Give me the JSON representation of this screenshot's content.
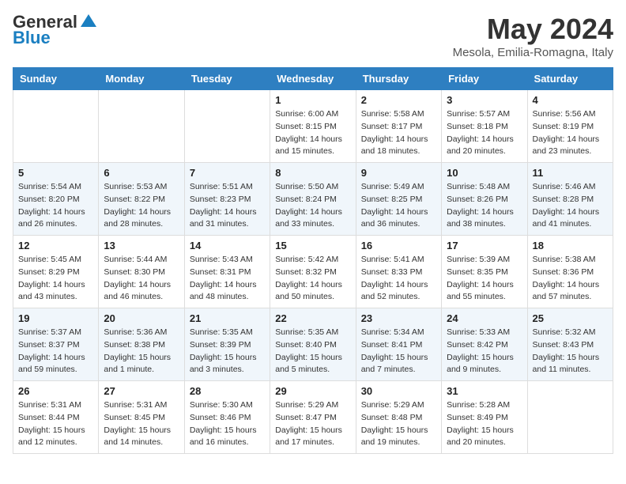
{
  "header": {
    "logo_line1": "General",
    "logo_line2": "Blue",
    "month_year": "May 2024",
    "location": "Mesola, Emilia-Romagna, Italy"
  },
  "days_of_week": [
    "Sunday",
    "Monday",
    "Tuesday",
    "Wednesday",
    "Thursday",
    "Friday",
    "Saturday"
  ],
  "weeks": [
    [
      {
        "day": "",
        "info": ""
      },
      {
        "day": "",
        "info": ""
      },
      {
        "day": "",
        "info": ""
      },
      {
        "day": "1",
        "info": "Sunrise: 6:00 AM\nSunset: 8:15 PM\nDaylight: 14 hours\nand 15 minutes."
      },
      {
        "day": "2",
        "info": "Sunrise: 5:58 AM\nSunset: 8:17 PM\nDaylight: 14 hours\nand 18 minutes."
      },
      {
        "day": "3",
        "info": "Sunrise: 5:57 AM\nSunset: 8:18 PM\nDaylight: 14 hours\nand 20 minutes."
      },
      {
        "day": "4",
        "info": "Sunrise: 5:56 AM\nSunset: 8:19 PM\nDaylight: 14 hours\nand 23 minutes."
      }
    ],
    [
      {
        "day": "5",
        "info": "Sunrise: 5:54 AM\nSunset: 8:20 PM\nDaylight: 14 hours\nand 26 minutes."
      },
      {
        "day": "6",
        "info": "Sunrise: 5:53 AM\nSunset: 8:22 PM\nDaylight: 14 hours\nand 28 minutes."
      },
      {
        "day": "7",
        "info": "Sunrise: 5:51 AM\nSunset: 8:23 PM\nDaylight: 14 hours\nand 31 minutes."
      },
      {
        "day": "8",
        "info": "Sunrise: 5:50 AM\nSunset: 8:24 PM\nDaylight: 14 hours\nand 33 minutes."
      },
      {
        "day": "9",
        "info": "Sunrise: 5:49 AM\nSunset: 8:25 PM\nDaylight: 14 hours\nand 36 minutes."
      },
      {
        "day": "10",
        "info": "Sunrise: 5:48 AM\nSunset: 8:26 PM\nDaylight: 14 hours\nand 38 minutes."
      },
      {
        "day": "11",
        "info": "Sunrise: 5:46 AM\nSunset: 8:28 PM\nDaylight: 14 hours\nand 41 minutes."
      }
    ],
    [
      {
        "day": "12",
        "info": "Sunrise: 5:45 AM\nSunset: 8:29 PM\nDaylight: 14 hours\nand 43 minutes."
      },
      {
        "day": "13",
        "info": "Sunrise: 5:44 AM\nSunset: 8:30 PM\nDaylight: 14 hours\nand 46 minutes."
      },
      {
        "day": "14",
        "info": "Sunrise: 5:43 AM\nSunset: 8:31 PM\nDaylight: 14 hours\nand 48 minutes."
      },
      {
        "day": "15",
        "info": "Sunrise: 5:42 AM\nSunset: 8:32 PM\nDaylight: 14 hours\nand 50 minutes."
      },
      {
        "day": "16",
        "info": "Sunrise: 5:41 AM\nSunset: 8:33 PM\nDaylight: 14 hours\nand 52 minutes."
      },
      {
        "day": "17",
        "info": "Sunrise: 5:39 AM\nSunset: 8:35 PM\nDaylight: 14 hours\nand 55 minutes."
      },
      {
        "day": "18",
        "info": "Sunrise: 5:38 AM\nSunset: 8:36 PM\nDaylight: 14 hours\nand 57 minutes."
      }
    ],
    [
      {
        "day": "19",
        "info": "Sunrise: 5:37 AM\nSunset: 8:37 PM\nDaylight: 14 hours\nand 59 minutes."
      },
      {
        "day": "20",
        "info": "Sunrise: 5:36 AM\nSunset: 8:38 PM\nDaylight: 15 hours\nand 1 minute."
      },
      {
        "day": "21",
        "info": "Sunrise: 5:35 AM\nSunset: 8:39 PM\nDaylight: 15 hours\nand 3 minutes."
      },
      {
        "day": "22",
        "info": "Sunrise: 5:35 AM\nSunset: 8:40 PM\nDaylight: 15 hours\nand 5 minutes."
      },
      {
        "day": "23",
        "info": "Sunrise: 5:34 AM\nSunset: 8:41 PM\nDaylight: 15 hours\nand 7 minutes."
      },
      {
        "day": "24",
        "info": "Sunrise: 5:33 AM\nSunset: 8:42 PM\nDaylight: 15 hours\nand 9 minutes."
      },
      {
        "day": "25",
        "info": "Sunrise: 5:32 AM\nSunset: 8:43 PM\nDaylight: 15 hours\nand 11 minutes."
      }
    ],
    [
      {
        "day": "26",
        "info": "Sunrise: 5:31 AM\nSunset: 8:44 PM\nDaylight: 15 hours\nand 12 minutes."
      },
      {
        "day": "27",
        "info": "Sunrise: 5:31 AM\nSunset: 8:45 PM\nDaylight: 15 hours\nand 14 minutes."
      },
      {
        "day": "28",
        "info": "Sunrise: 5:30 AM\nSunset: 8:46 PM\nDaylight: 15 hours\nand 16 minutes."
      },
      {
        "day": "29",
        "info": "Sunrise: 5:29 AM\nSunset: 8:47 PM\nDaylight: 15 hours\nand 17 minutes."
      },
      {
        "day": "30",
        "info": "Sunrise: 5:29 AM\nSunset: 8:48 PM\nDaylight: 15 hours\nand 19 minutes."
      },
      {
        "day": "31",
        "info": "Sunrise: 5:28 AM\nSunset: 8:49 PM\nDaylight: 15 hours\nand 20 minutes."
      },
      {
        "day": "",
        "info": ""
      }
    ]
  ]
}
